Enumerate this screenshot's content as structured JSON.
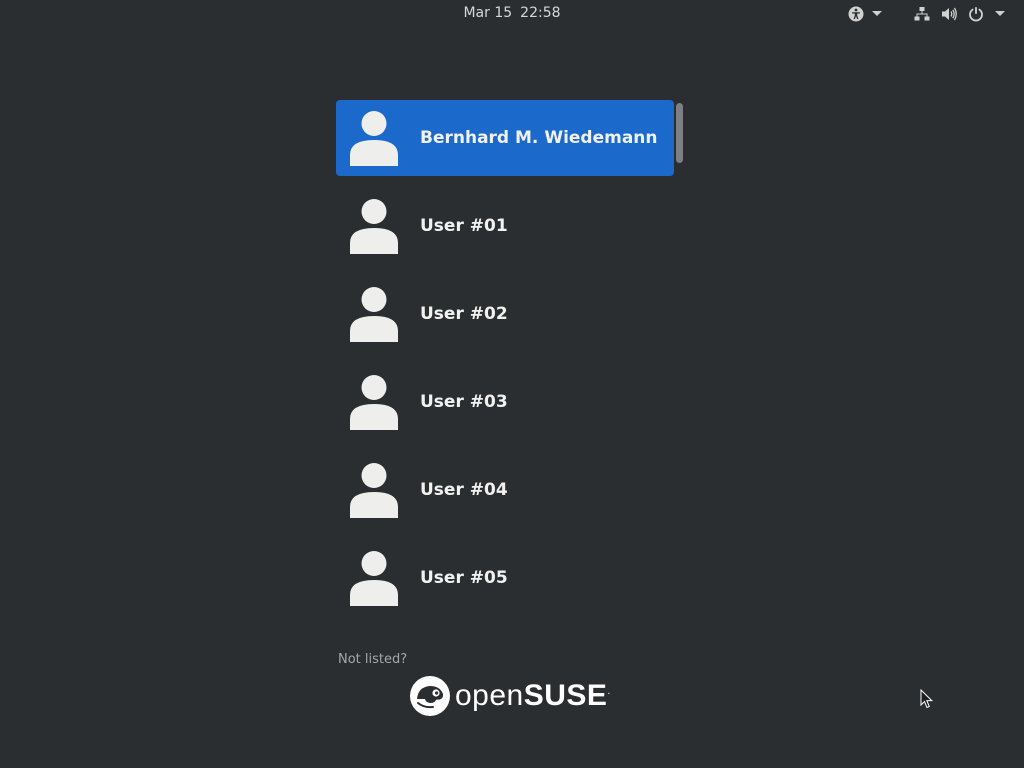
{
  "topbar": {
    "date": "Mar 15",
    "time": "22:58",
    "icons": [
      "accessibility-icon",
      "network-icon",
      "volume-icon",
      "power-icon"
    ]
  },
  "users": [
    {
      "name": "Bernhard M. Wiedemann",
      "selected": true
    },
    {
      "name": "User #01",
      "selected": false
    },
    {
      "name": "User #02",
      "selected": false
    },
    {
      "name": "User #03",
      "selected": false
    },
    {
      "name": "User #04",
      "selected": false
    },
    {
      "name": "User #05",
      "selected": false
    }
  ],
  "not_listed_label": "Not listed?",
  "logo": {
    "text_light": "open",
    "text_bold": "SUSE",
    "mark": "."
  },
  "colors": {
    "background": "#2b2e30",
    "selection": "#1b6acb",
    "avatar": "#eeeeec"
  }
}
